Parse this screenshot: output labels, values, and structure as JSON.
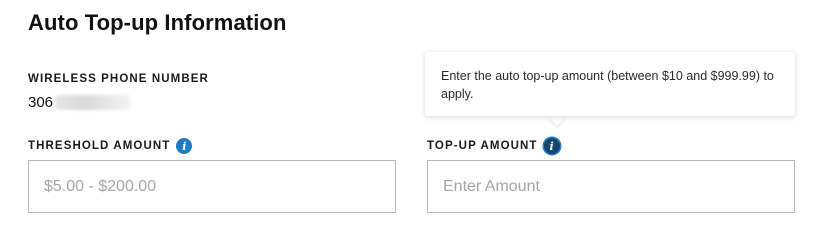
{
  "title": "Auto Top-up Information",
  "wireless_phone": {
    "label": "WIRELESS PHONE NUMBER",
    "value_prefix": "306"
  },
  "threshold": {
    "label": "THRESHOLD AMOUNT",
    "placeholder": "$5.00 - $200.00",
    "info_icon": "info-icon"
  },
  "topup": {
    "label": "TOP-UP AMOUNT",
    "placeholder": "Enter Amount",
    "info_icon": "info-icon",
    "tooltip": "Enter the auto top-up amount (between $10 and $999.99) to apply."
  },
  "colors": {
    "info_icon": "#1e7cc3",
    "info_icon_active": "#14466d",
    "field_border": "#b8b8b8"
  }
}
